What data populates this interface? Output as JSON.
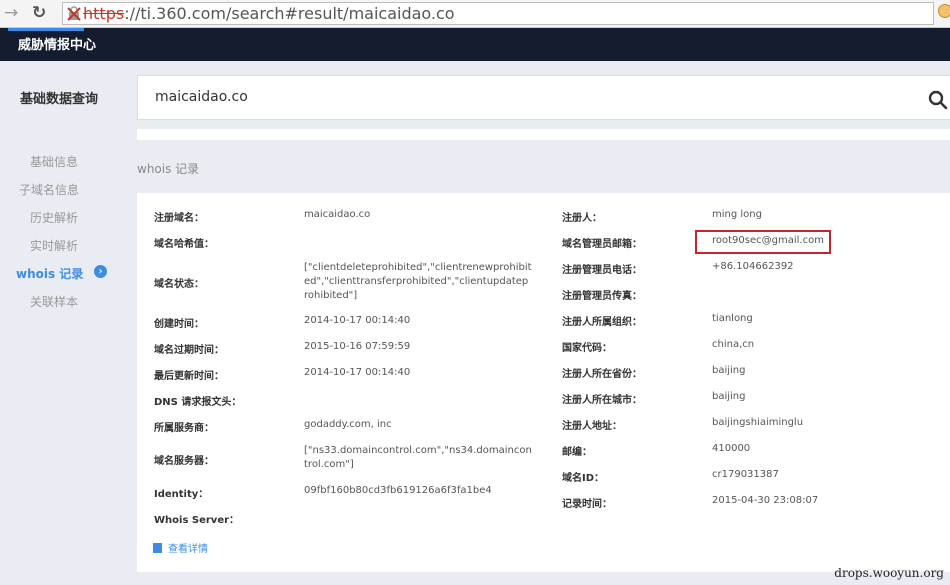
{
  "browser": {
    "url_scheme": "https",
    "url_rest": "://ti.360.com/search#result/maicaidao.co"
  },
  "header": {
    "title": "威胁情报中心"
  },
  "sidebar": {
    "title": "基础数据查询",
    "items": [
      {
        "label": "基础信息"
      },
      {
        "label": "子域名信息"
      },
      {
        "label": "历史解析"
      },
      {
        "label": "实时解析"
      },
      {
        "label": "whois 记录"
      },
      {
        "label": "关联样本"
      }
    ]
  },
  "search": {
    "value": "maicaidao.co"
  },
  "section": {
    "title": "whois 记录"
  },
  "left": [
    {
      "label": "注册域名：",
      "value": "maicaidao.co"
    },
    {
      "label": "域名哈希值：",
      "value": ""
    },
    {
      "label": "域名状态：",
      "value": "[\"clientdeleteprohibited\",\"clientrenewprohibited\",\"clienttransferprohibited\",\"clientupdateprohibited\"]"
    },
    {
      "label": "创建时间：",
      "value": "2014-10-17 00:14:40"
    },
    {
      "label": "域名过期时间：",
      "value": "2015-10-16 07:59:59"
    },
    {
      "label": "最后更新时间：",
      "value": "2014-10-17 00:14:40"
    },
    {
      "label": "DNS 请求报文头：",
      "value": ""
    },
    {
      "label": "所属服务商：",
      "value": "godaddy.com, inc"
    },
    {
      "label": "域名服务器：",
      "value": "[\"ns33.domaincontrol.com\",\"ns34.domaincontrol.com\"]"
    },
    {
      "label": "Identity：",
      "value": "09fbf160b80cd3fb619126a6f3fa1be4"
    },
    {
      "label": "Whois Server：",
      "value": ""
    }
  ],
  "right": [
    {
      "label": "注册人：",
      "value": "ming long"
    },
    {
      "label": "域名管理员邮箱：",
      "value": "root90sec@gmail.com"
    },
    {
      "label": "注册管理员电话：",
      "value": "+86.104662392"
    },
    {
      "label": "注册管理员传真：",
      "value": ""
    },
    {
      "label": "注册人所属组织：",
      "value": "tianlong"
    },
    {
      "label": "国家代码：",
      "value": "china,cn"
    },
    {
      "label": "注册人所在省份：",
      "value": "baijing"
    },
    {
      "label": "注册人所在城市：",
      "value": "baijing"
    },
    {
      "label": "注册人地址：",
      "value": "baijingshiaiminglu"
    },
    {
      "label": "邮编：",
      "value": "410000"
    },
    {
      "label": "域名ID：",
      "value": "cr179031387"
    },
    {
      "label": "记录时间：",
      "value": "2015-04-30 23:08:07"
    }
  ],
  "detail_link": "查看详情",
  "watermark": "drops.wooyun.org",
  "colors": {
    "accent": "#3b8ce8",
    "header_bg": "#141c30",
    "highlight": "#c0272d"
  }
}
